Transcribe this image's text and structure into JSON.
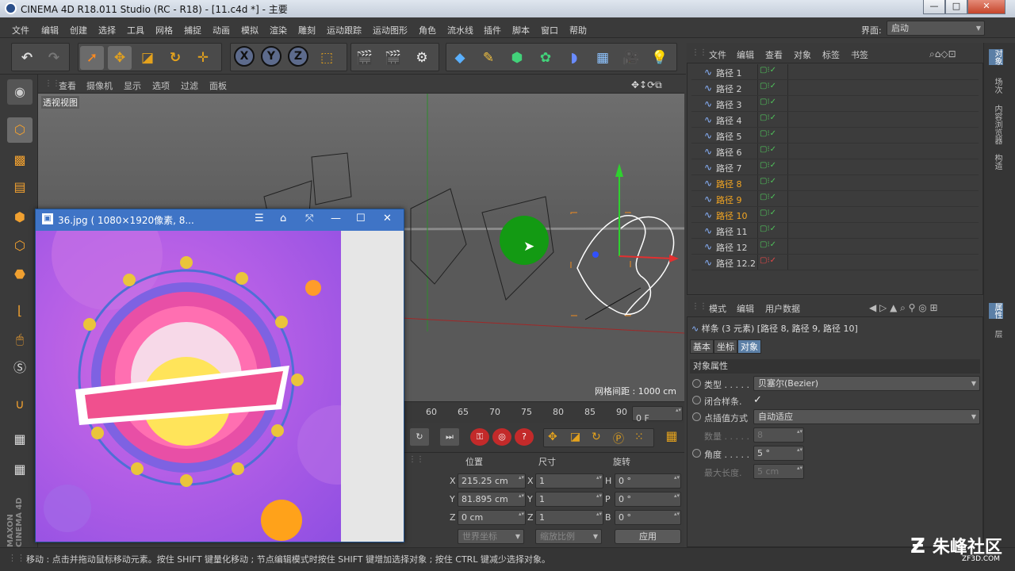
{
  "window": {
    "title": "CINEMA 4D R18.011 Studio (RC - R18) - [11.c4d *] - 主要",
    "min": "—",
    "max": "□",
    "close": "✕"
  },
  "menu": {
    "items": [
      "文件",
      "编辑",
      "创建",
      "选择",
      "工具",
      "网格",
      "捕捉",
      "动画",
      "模拟",
      "渲染",
      "雕刻",
      "运动跟踪",
      "运动图形",
      "角色",
      "流水线",
      "插件",
      "脚本",
      "窗口",
      "帮助"
    ],
    "layout_label": "界面:",
    "layout_value": "启动"
  },
  "viewport": {
    "menu": [
      "查看",
      "摄像机",
      "显示",
      "选项",
      "过滤",
      "面板"
    ],
    "view_label": "透视视图",
    "grid_spacing": "网格间距 : 1000 cm"
  },
  "timeline": {
    "ticks": [
      "60",
      "65",
      "70",
      "75",
      "80",
      "85",
      "90"
    ],
    "frame": "0 F"
  },
  "coords": {
    "headers": [
      "位置",
      "尺寸",
      "旋转"
    ],
    "rows": [
      {
        "a": "X",
        "pos": "215.25 cm",
        "b": "X",
        "size": "1",
        "c": "H",
        "rot": "0 °"
      },
      {
        "a": "Y",
        "pos": "81.895 cm",
        "b": "Y",
        "size": "1",
        "c": "P",
        "rot": "0 °"
      },
      {
        "a": "Z",
        "pos": "0 cm",
        "b": "Z",
        "size": "1",
        "c": "B",
        "rot": "0 °"
      }
    ],
    "world": "世界坐标",
    "scale": "缩放比例",
    "apply": "应用"
  },
  "objects": {
    "menu": [
      "文件",
      "编辑",
      "查看",
      "对象",
      "标签",
      "书签"
    ],
    "items": [
      {
        "name": "路径 1",
        "sel": false
      },
      {
        "name": "路径 2",
        "sel": false
      },
      {
        "name": "路径 3",
        "sel": false
      },
      {
        "name": "路径 4",
        "sel": false
      },
      {
        "name": "路径 5",
        "sel": false
      },
      {
        "name": "路径 6",
        "sel": false
      },
      {
        "name": "路径 7",
        "sel": false
      },
      {
        "name": "路径 8",
        "sel": true
      },
      {
        "name": "路径 9",
        "sel": true
      },
      {
        "name": "路径 10",
        "sel": true
      },
      {
        "name": "路径 11",
        "sel": false
      },
      {
        "name": "路径 12",
        "sel": false
      },
      {
        "name": "路径 12.2",
        "sel": false
      }
    ]
  },
  "attributes": {
    "menu": [
      "模式",
      "编辑",
      "用户数据"
    ],
    "object_line": "样条 (3 元素) [路径 8, 路径 9, 路径 10]",
    "tabs": [
      "基本",
      "坐标",
      "对象"
    ],
    "section": "对象属性",
    "props": {
      "type_label": "类型 . . . . .",
      "type_value": "贝塞尔(Bezier)",
      "close_label": "闭合样条.",
      "close_check": "✓",
      "interp_label": "点插值方式",
      "interp_value": "自动适应",
      "count_label": "数量 . . . . .",
      "count_value": "8",
      "angle_label": "角度 . . . . .",
      "angle_value": "5 °",
      "maxlen_label": "最大长度.",
      "maxlen_value": "5 cm"
    }
  },
  "sidetabs": [
    "对象",
    "场次",
    "内容浏览器",
    "构造",
    "属性",
    "层"
  ],
  "status": "移动 : 点击并拖动鼠标移动元素。按住 SHIFT 键量化移动 ; 节点编辑模式时按住 SHIFT 键增加选择对象 ; 按住 CTRL 键减少选择对象。",
  "image_window": {
    "title": "36.jpg ( 1080×1920像素, 8..."
  },
  "left_logo": "MAXON CINEMA 4D",
  "watermark": {
    "text": "朱峰社区",
    "sub": "ZF3D.COM"
  }
}
